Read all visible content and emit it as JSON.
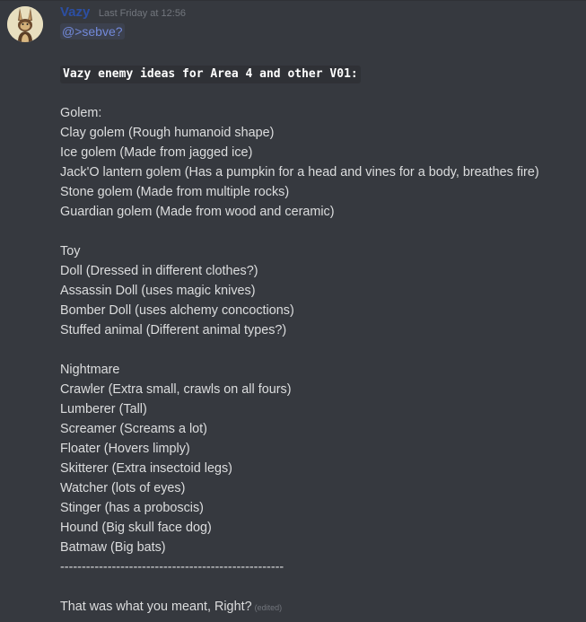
{
  "message": {
    "username": "Vazy",
    "timestamp": "Last Friday at 12:56",
    "mention": "@>sebve?",
    "code_title": "Vazy enemy ideas for Area 4 and other V01:",
    "lines": [
      "Golem:",
      "Clay golem (Rough humanoid shape)",
      "Ice golem (Made from jagged ice)",
      "Jack'O lantern golem (Has a pumpkin for a head and vines for a body, breathes fire)",
      "Stone golem (Made from multiple rocks)",
      "Guardian golem (Made from wood and ceramic)",
      "Toy",
      "Doll (Dressed in different clothes?)",
      "Assassin Doll (uses magic knives)",
      "Bomber Doll (uses alchemy concoctions)",
      "Stuffed animal (Different animal types?)",
      "Nightmare",
      "Crawler (Extra small, crawls on all fours)",
      "Lumberer (Tall)",
      "Screamer (Screams a lot)",
      "Floater (Hovers limply)",
      "Skitterer (Extra insectoid legs)",
      "Watcher (lots of eyes)",
      "Stinger (has a proboscis)",
      "Hound (Big skull face dog)",
      "Batmaw (Big bats)",
      "----------------------------------------------------",
      "That was what you meant, Right?"
    ],
    "edited_label": "(edited)"
  },
  "colors": {
    "background": "#36393f",
    "username": "#2c4fa3",
    "mention": "#7289da",
    "text": "#dcddde",
    "muted": "#72767d"
  },
  "icons": {
    "avatar": "bunny-avatar"
  }
}
